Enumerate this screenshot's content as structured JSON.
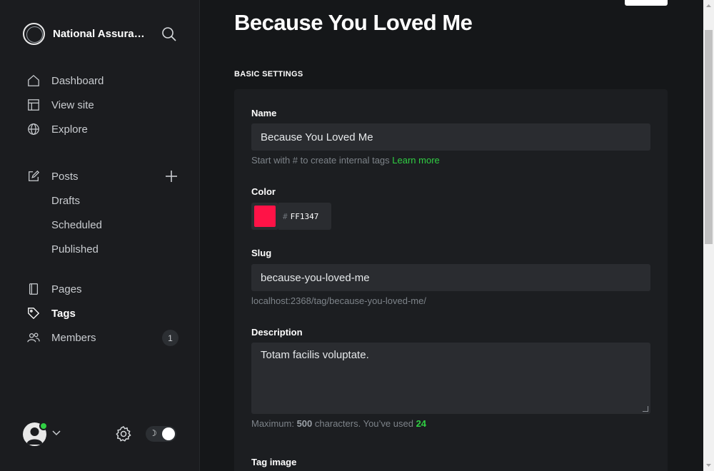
{
  "sidebar": {
    "site_name": "National Assurance",
    "nav_primary": [
      {
        "label": "Dashboard",
        "icon": "home-icon"
      },
      {
        "label": "View site",
        "icon": "layout-icon"
      },
      {
        "label": "Explore",
        "icon": "globe-icon"
      }
    ],
    "posts": {
      "label": "Posts",
      "sub": [
        "Drafts",
        "Scheduled",
        "Published"
      ]
    },
    "nav_secondary": [
      {
        "label": "Pages",
        "icon": "page-icon"
      },
      {
        "label": "Tags",
        "icon": "tag-icon"
      },
      {
        "label": "Members",
        "icon": "members-icon",
        "badge": "1"
      }
    ],
    "theme_toggle_icon": "☽"
  },
  "main": {
    "title": "Because You Loved Me",
    "section_title": "BASIC SETTINGS",
    "name": {
      "label": "Name",
      "value": "Because You Loved Me",
      "hint_text": "Start with # to create internal tags",
      "hint_link": "Learn more"
    },
    "color": {
      "label": "Color",
      "hash": "#",
      "value": "FF1347",
      "swatch": "#FF1347"
    },
    "slug": {
      "label": "Slug",
      "value": "because-you-loved-me",
      "url_hint": "localhost:2368/tag/because-you-loved-me/"
    },
    "description": {
      "label": "Description",
      "value": "Totam facilis voluptate.",
      "hint_prefix": "Maximum:",
      "max": "500",
      "hint_middle": "characters. You’ve used",
      "used": "24"
    },
    "tag_image": {
      "label": "Tag image"
    }
  },
  "colors": {
    "accent_green": "#30cf43",
    "background": "#151719",
    "sidebar": "#1b1c1f"
  }
}
